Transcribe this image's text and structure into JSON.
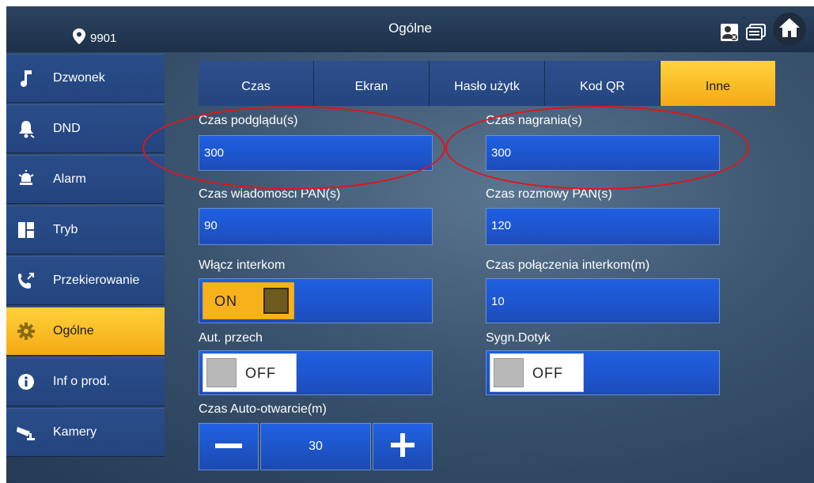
{
  "header": {
    "location_number": "9901",
    "title": "Ogólne"
  },
  "sidebar": {
    "items": [
      {
        "label": "Dzwonek",
        "icon": "music-note-icon",
        "active": false
      },
      {
        "label": "DND",
        "icon": "bell-icon",
        "active": false
      },
      {
        "label": "Alarm",
        "icon": "alarm-icon",
        "active": false
      },
      {
        "label": "Tryb",
        "icon": "layout-icon",
        "active": false
      },
      {
        "label": "Przekierowanie",
        "icon": "call-forward-icon",
        "active": false
      },
      {
        "label": "Ogólne",
        "icon": "gear-icon",
        "active": true
      },
      {
        "label": "Inf o prod.",
        "icon": "info-icon",
        "active": false
      },
      {
        "label": "Kamery",
        "icon": "camera-icon",
        "active": false
      }
    ]
  },
  "tabs": [
    {
      "label": "Czas",
      "active": false
    },
    {
      "label": "Ekran",
      "active": false
    },
    {
      "label": "Hasło użytk",
      "active": false
    },
    {
      "label": "Kod QR",
      "active": false
    },
    {
      "label": "Inne",
      "active": true
    }
  ],
  "fields": {
    "preview_time": {
      "label": "Czas podglądu(s)",
      "value": "300"
    },
    "record_time": {
      "label": "Czas nagrania(s)",
      "value": "300"
    },
    "pan_message_time": {
      "label": "Czas wiadomości PAN(s)",
      "value": "90"
    },
    "pan_talk_time": {
      "label": "Czas rozmowy PAN(s)",
      "value": "120"
    },
    "intercom_enable": {
      "label": "Włącz interkom",
      "state": "ON"
    },
    "intercom_call_time": {
      "label": "Czas połączenia interkom(m)",
      "value": "10"
    },
    "auto_switch": {
      "label": "Aut. przech",
      "state": "OFF"
    },
    "touch_signal": {
      "label": "Sygn.Dotyk",
      "state": "OFF"
    },
    "auto_open_time": {
      "label": "Czas Auto-otwarcie(m)",
      "value": "30"
    }
  },
  "colors": {
    "accent": "#f5a914",
    "field_blue": "#1e55cd",
    "annotation_red": "#e0151c"
  }
}
